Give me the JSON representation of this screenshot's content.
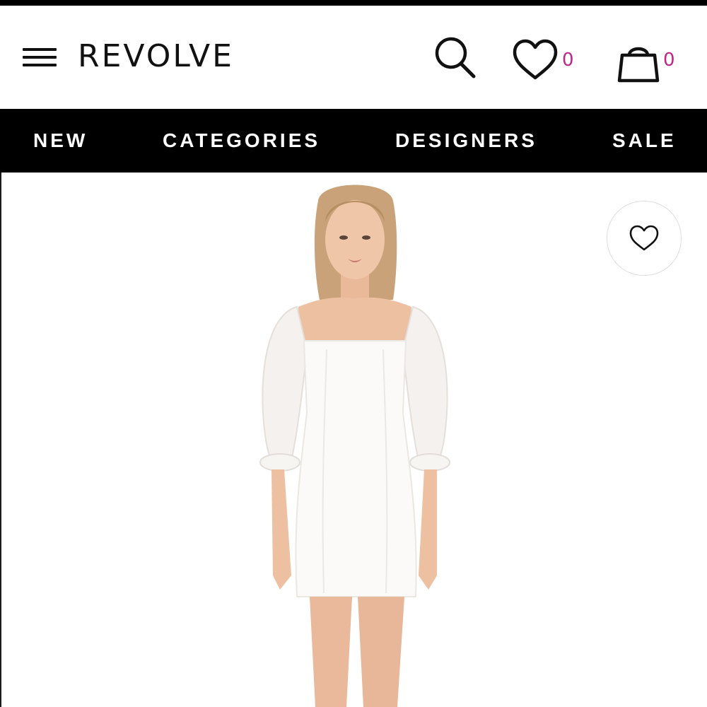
{
  "header": {
    "brand": "REVOLVE",
    "wishlist_count": "0",
    "bag_count": "0",
    "count_color": "#c0258c",
    "icons": [
      "menu-icon",
      "search-icon",
      "heart-icon",
      "shopping-bag-icon"
    ]
  },
  "nav": {
    "items": [
      {
        "label": "NEW"
      },
      {
        "label": "CATEGORIES"
      },
      {
        "label": "DESIGNERS"
      },
      {
        "label": "SALE"
      }
    ]
  },
  "product": {
    "image": "model wearing white mini dress with sheer puff sleeves",
    "favorite_icon": "heart-outline-icon"
  }
}
